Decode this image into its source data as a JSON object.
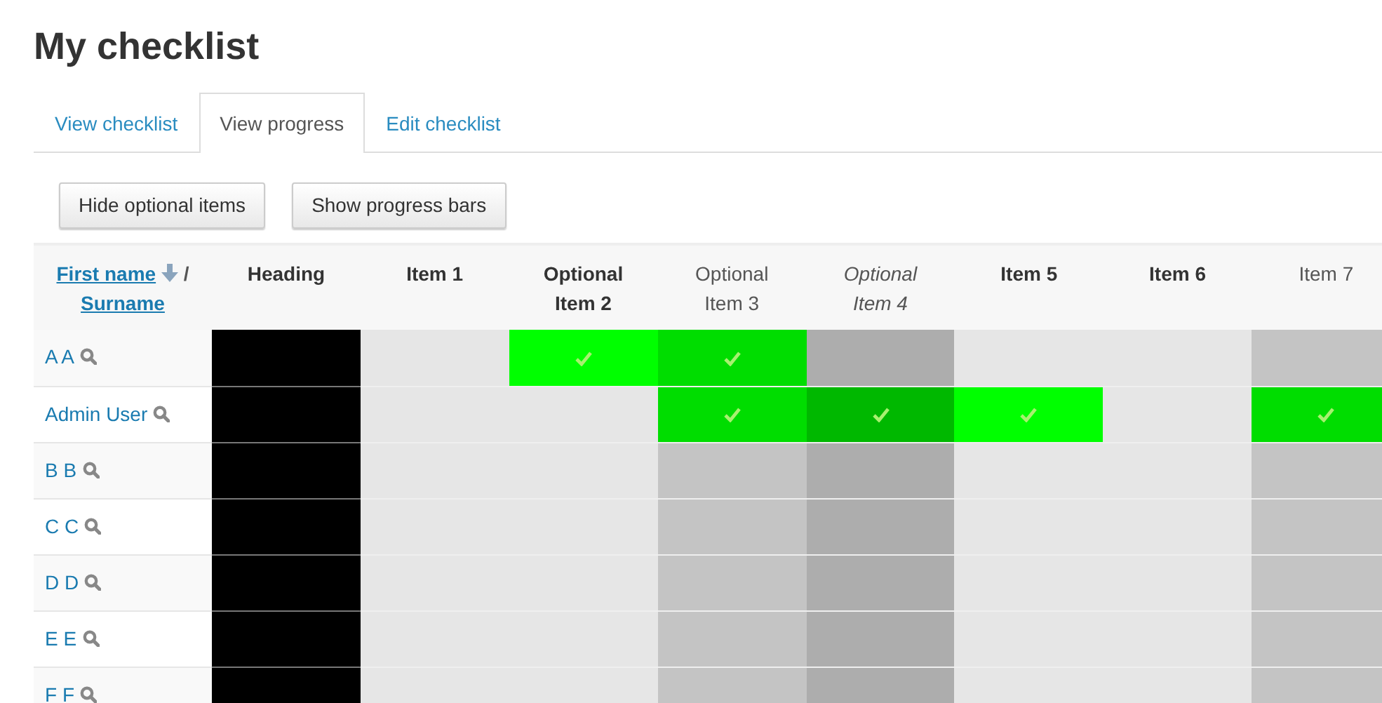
{
  "title": "My checklist",
  "tabs": [
    {
      "label": "View checklist",
      "selected": false
    },
    {
      "label": "View progress",
      "selected": true
    },
    {
      "label": "Edit checklist",
      "selected": false
    }
  ],
  "buttons": [
    "Hide optional items",
    "Show progress bars"
  ],
  "table": {
    "name_header": {
      "first": "First name",
      "separator": "/",
      "second": "Surname"
    },
    "columns": [
      {
        "label": "Heading",
        "kind": "heading"
      },
      {
        "label": "Item 1",
        "kind": "required"
      },
      {
        "label": "Optional Item 2",
        "kind": "required"
      },
      {
        "label": "Optional Item 3",
        "kind": "optional"
      },
      {
        "label": "Optional Item 4",
        "kind": "italic"
      },
      {
        "label": "Item 5",
        "kind": "required"
      },
      {
        "label": "Item 6",
        "kind": "required"
      },
      {
        "label": "Item 7",
        "kind": "optional"
      }
    ],
    "rows": [
      {
        "name": "A A",
        "checked": [
          false,
          true,
          true,
          false,
          false,
          false,
          false
        ]
      },
      {
        "name": "Admin User",
        "checked": [
          false,
          false,
          true,
          true,
          true,
          false,
          true
        ]
      },
      {
        "name": "B B",
        "checked": [
          false,
          false,
          false,
          false,
          false,
          false,
          false
        ]
      },
      {
        "name": "C C",
        "checked": [
          false,
          false,
          false,
          false,
          false,
          false,
          false
        ]
      },
      {
        "name": "D D",
        "checked": [
          false,
          false,
          false,
          false,
          false,
          false,
          false
        ]
      },
      {
        "name": "E E",
        "checked": [
          false,
          false,
          false,
          false,
          false,
          false,
          false
        ]
      },
      {
        "name": "F F",
        "checked": [
          false,
          false,
          false,
          false,
          false,
          false,
          false
        ]
      }
    ]
  }
}
